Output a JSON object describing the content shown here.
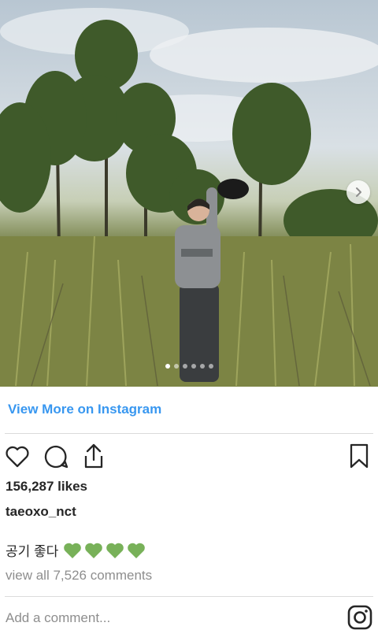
{
  "post": {
    "image_alt": "Person in grey sweatshirt holding a black cap up among tall grass and trees",
    "carousel_dot_count": 6,
    "carousel_active_index": 0
  },
  "view_more_label": "View More on Instagram",
  "actions": {
    "like_icon": "heart-outline-icon",
    "comment_icon": "comment-bubble-icon",
    "share_icon": "share-upload-icon",
    "save_icon": "bookmark-icon"
  },
  "likes_text": "156,287 likes",
  "username": "taeoxo_nct",
  "caption": {
    "text": "공기 좋다",
    "emoji_icon": "green-heart-icon",
    "emoji_count": 4
  },
  "comments_link": "view all 7,526 comments",
  "add_comment_placeholder": "Add a comment...",
  "brand_icon": "instagram-logo-icon",
  "colors": {
    "link_blue": "#3897f0",
    "text": "#262626",
    "muted": "#8e8e8e",
    "divider": "#dbdbdb",
    "green_heart": "#78b159"
  }
}
